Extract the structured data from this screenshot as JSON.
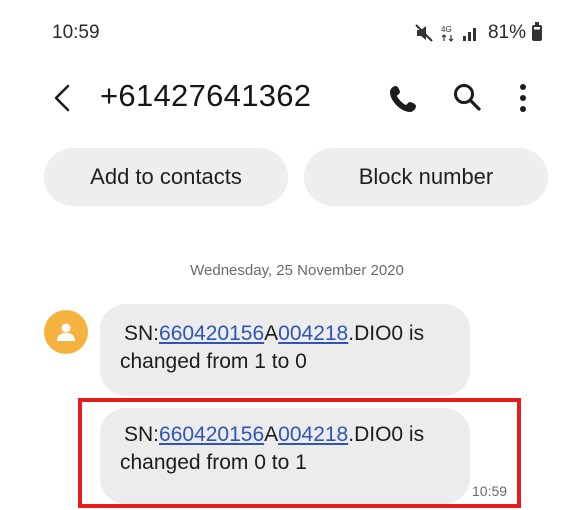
{
  "status_bar": {
    "time": "10:59",
    "network": "4G",
    "battery_percent": "81%",
    "icons": [
      "mute-icon",
      "network-4g-icon",
      "signal-icon",
      "battery-icon"
    ]
  },
  "header": {
    "back_icon": "back-arrow-icon",
    "title": "+61427641362",
    "actions": [
      "call-icon",
      "search-icon",
      "more-options-icon"
    ]
  },
  "actions": {
    "add_to_contacts": "Add to contacts",
    "block_number": "Block number"
  },
  "conversation": {
    "date": "Wednesday, 25 November 2020",
    "avatar_icon": "contact-avatar-icon",
    "messages": [
      {
        "prefix": "SN:",
        "link1": "660420156",
        "mid": "A",
        "link2": "004218",
        "suffix": ".DIO0 is",
        "line2": "changed from 1 to 0",
        "time": ""
      },
      {
        "prefix": "SN:",
        "link1": "660420156",
        "mid": "A",
        "link2": "004218",
        "suffix": ".DIO0 is",
        "line2": "changed from 0 to 1",
        "time": "10:59",
        "highlighted": true
      }
    ]
  },
  "colors": {
    "accent_link": "#2f55b5",
    "avatar": "#f6b23f",
    "bubble": "#ececec",
    "highlight": "#e81c1c"
  }
}
